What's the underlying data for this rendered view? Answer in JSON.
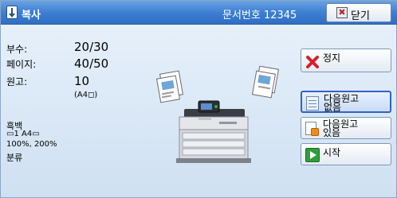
{
  "title_bar": {
    "title": "복사",
    "document_number": "문서번호 12345",
    "close_label": "닫기"
  },
  "job_info": {
    "copies_label": "부수:",
    "copies_value": "20/30",
    "pages_label": "페이지:",
    "pages_value": "40/50",
    "originals_label": "원고:",
    "originals_value": "10",
    "original_size": "(A4◻)",
    "color_mode": "흑백",
    "tray_and_paper": "▭1  A4▭",
    "scale": "100%, 200%",
    "sort": "분류"
  },
  "buttons": {
    "stop": "정지",
    "no_more_originals": [
      "다음원고",
      "없음"
    ],
    "more_originals": [
      "다음원고",
      "있음"
    ],
    "start": "시작"
  },
  "icons": {
    "title": "copy-down-arrow-icon",
    "close": "close-x-icon",
    "stop": "red-x-icon",
    "no_more": "document-icon",
    "more": "document-plus-icon",
    "start": "green-play-icon",
    "illustration": "copier-machine-icon"
  },
  "colors": {
    "title_bar": "#3d7fd3",
    "selected_border": "#2f62c8",
    "stop_red": "#d6202a",
    "start_green": "#2e9e3b"
  }
}
